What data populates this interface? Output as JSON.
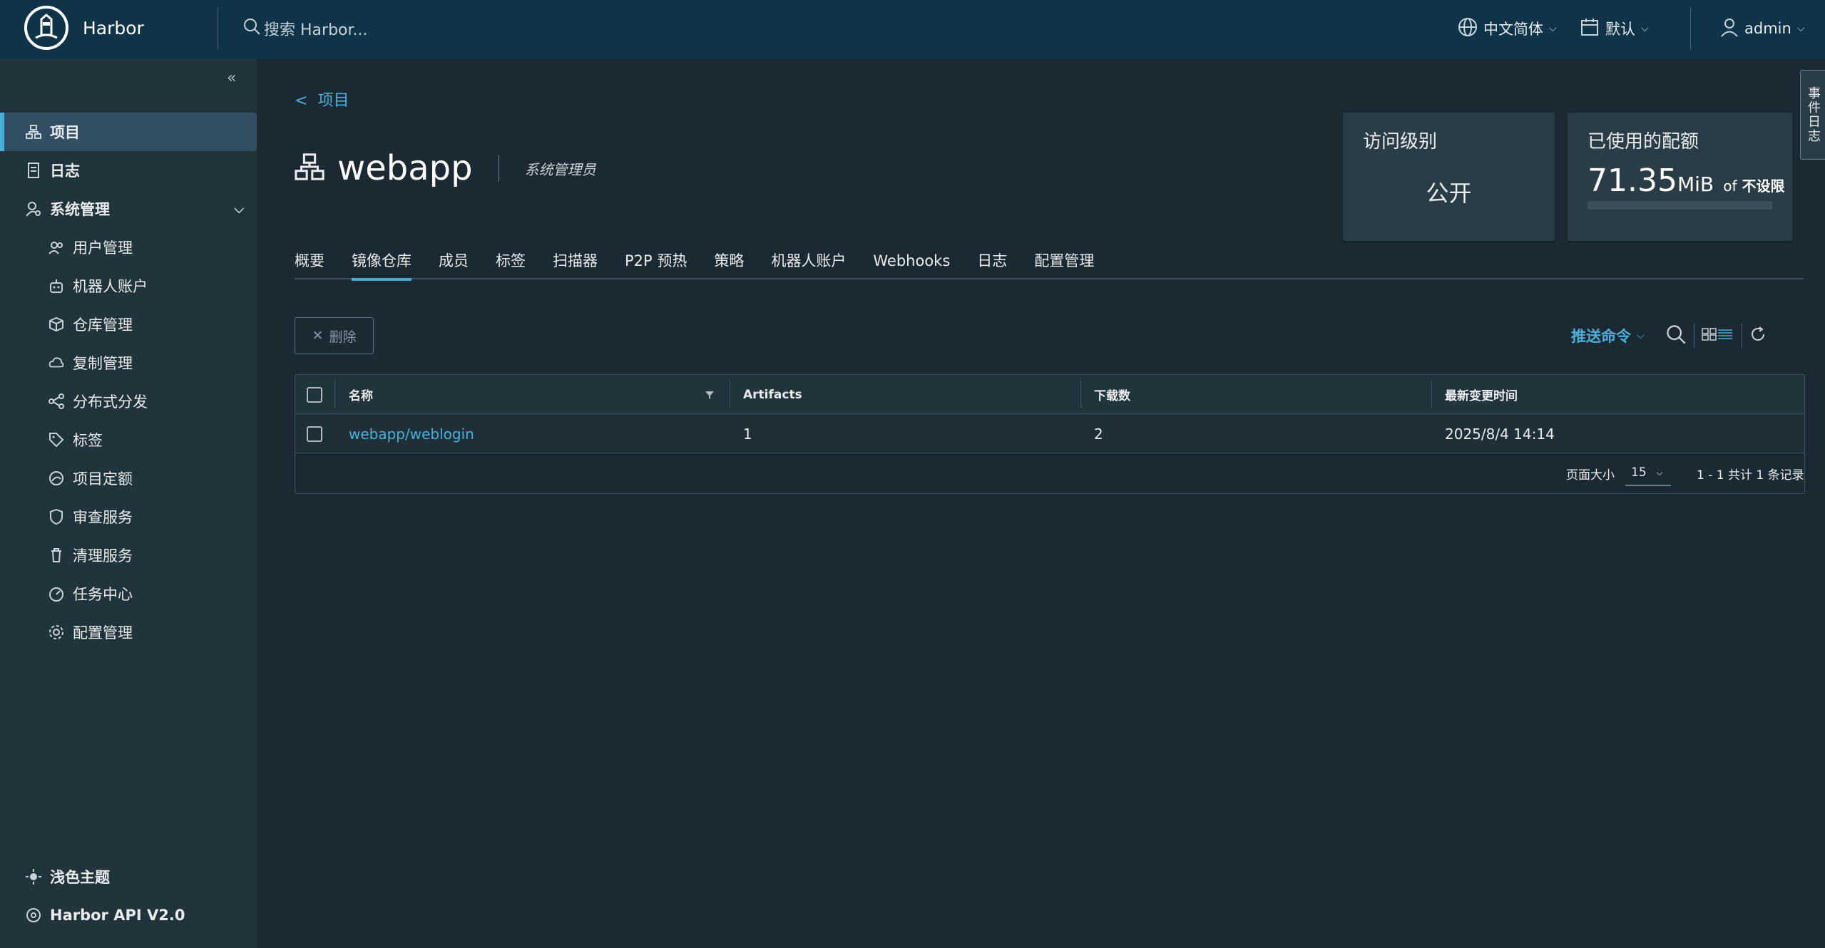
{
  "header": {
    "brand": "Harbor",
    "search_placeholder": "搜索 Harbor...",
    "language": "中文简体",
    "date_format": "默认",
    "user": "admin"
  },
  "sidebar": {
    "items": [
      {
        "label": "项目",
        "icon": "projects-icon"
      },
      {
        "label": "日志",
        "icon": "logs-icon"
      },
      {
        "label": "系统管理",
        "icon": "admin-icon"
      },
      {
        "label": "用户管理",
        "icon": "users-icon"
      },
      {
        "label": "机器人账户",
        "icon": "robot-icon"
      },
      {
        "label": "仓库管理",
        "icon": "registry-icon"
      },
      {
        "label": "复制管理",
        "icon": "replication-icon"
      },
      {
        "label": "分布式分发",
        "icon": "distribution-icon"
      },
      {
        "label": "标签",
        "icon": "tag-icon"
      },
      {
        "label": "项目定额",
        "icon": "quota-icon"
      },
      {
        "label": "审查服务",
        "icon": "shield-icon"
      },
      {
        "label": "清理服务",
        "icon": "trash-icon"
      },
      {
        "label": "任务中心",
        "icon": "dashboard-icon"
      },
      {
        "label": "配置管理",
        "icon": "gear-icon"
      }
    ],
    "theme_label": "浅色主题",
    "api_label": "Harbor API V2.0"
  },
  "main": {
    "back_label": "项目",
    "project_name": "webapp",
    "role": "系统管理员",
    "access_card": {
      "title": "访问级别",
      "value": "公开"
    },
    "quota_card": {
      "title": "已使用的配额",
      "used_value": "71.35",
      "used_unit": "MiB",
      "of_label": "of",
      "limit": "不设限",
      "fill_fraction": 0.0
    },
    "tabs": [
      "概要",
      "镜像仓库",
      "成员",
      "标签",
      "扫描器",
      "P2P 预热",
      "策略",
      "机器人账户",
      "Webhooks",
      "日志",
      "配置管理"
    ],
    "active_tab": "镜像仓库",
    "delete_label": "删除",
    "push_command_label": "推送命令",
    "table": {
      "columns": [
        "名称",
        "Artifacts",
        "下载数",
        "最新变更时间"
      ],
      "rows": [
        {
          "name": "webapp/weblogin",
          "artifacts": "1",
          "downloads": "2",
          "updated": "2025/8/4 14:14"
        }
      ],
      "page_size_label": "页面大小",
      "page_size": "15",
      "summary": "1 - 1 共计 1 条记录"
    }
  },
  "event_tab_label": "事件日志",
  "colors": {
    "accent": "#4aaed9",
    "header_bg": "#0f3347",
    "sidebar_bg": "#21333b",
    "main_bg": "#1b2a32"
  }
}
